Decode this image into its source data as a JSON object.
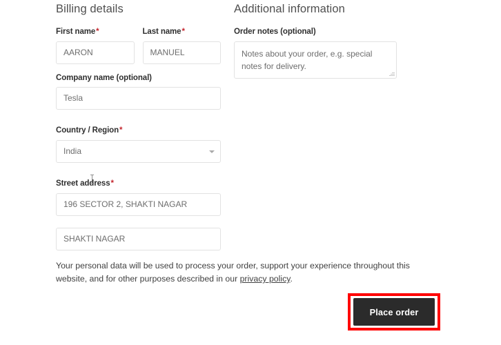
{
  "billing": {
    "heading": "Billing details",
    "first_name": {
      "label": "First name",
      "required_mark": "*",
      "value": "AARON"
    },
    "last_name": {
      "label": "Last name",
      "required_mark": "*",
      "value": "MANUEL"
    },
    "company": {
      "label": "Company name (optional)",
      "value": "Tesla"
    },
    "country": {
      "label": "Country / Region",
      "required_mark": "*",
      "value": "India",
      "icon": "chevron-down-icon"
    },
    "street": {
      "label": "Street address",
      "required_mark": "*",
      "line1": "196 SECTOR 2, SHAKTI NAGAR",
      "line2": "SHAKTI NAGAR"
    }
  },
  "additional": {
    "heading": "Additional information",
    "order_notes": {
      "label": "Order notes (optional)",
      "placeholder": "Notes about your order, e.g. special notes for delivery.",
      "resize_icon": "resize-grip-icon"
    }
  },
  "privacy": {
    "text_before": "Your personal data will be used to process your order, support your experience throughout this website, and for other purposes described in our ",
    "link_text": "privacy policy",
    "text_after": "."
  },
  "actions": {
    "place_order_label": "Place order"
  },
  "colors": {
    "annotation": "#ff0000",
    "button_bg": "#2b2b2b",
    "required": "#c4262e",
    "border": "#e2e2e2"
  }
}
